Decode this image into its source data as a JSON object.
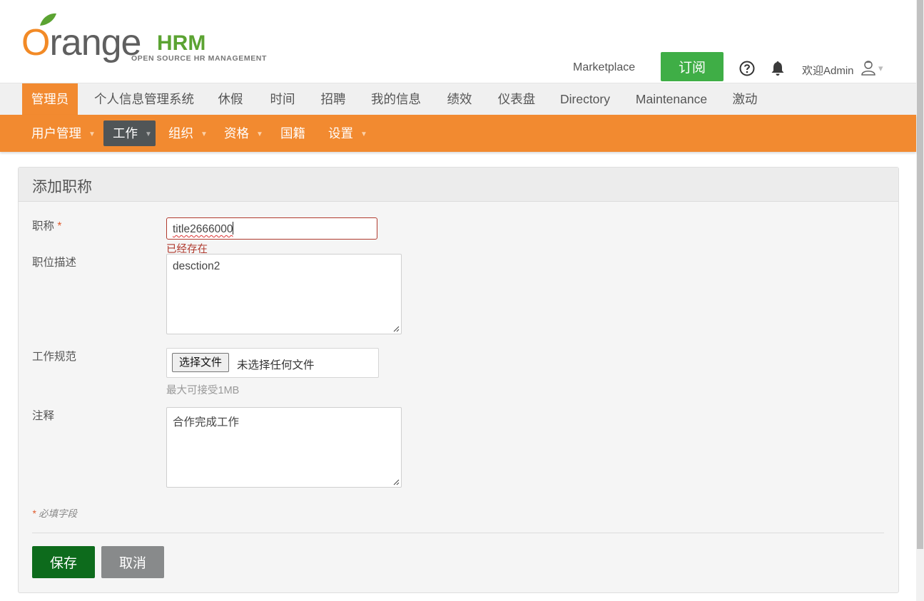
{
  "header": {
    "logo_main": "range",
    "logo_o": "O",
    "logo_hrm": "HRM",
    "logo_sub": "OPEN SOURCE HR MANAGEMENT",
    "marketplace_label": "Marketplace",
    "subscribe_label": "订阅",
    "welcome_text": "欢迎Admin",
    "caret": "▾"
  },
  "topnav": {
    "items": [
      {
        "label": "管理员",
        "active": true
      },
      {
        "label": "个人信息管理系统"
      },
      {
        "label": "休假"
      },
      {
        "label": "时间"
      },
      {
        "label": "招聘"
      },
      {
        "label": "我的信息"
      },
      {
        "label": "绩效"
      },
      {
        "label": "仪表盘"
      },
      {
        "label": "Directory"
      },
      {
        "label": "Maintenance"
      },
      {
        "label": "激动"
      }
    ]
  },
  "subnav": {
    "items": [
      {
        "label": "用户管理",
        "dropdown": true
      },
      {
        "label": "工作",
        "dropdown": true,
        "active": true
      },
      {
        "label": "组织",
        "dropdown": true
      },
      {
        "label": "资格",
        "dropdown": true
      },
      {
        "label": "国籍",
        "dropdown": false
      },
      {
        "label": "设置",
        "dropdown": true
      }
    ],
    "caret": "▼"
  },
  "form": {
    "title": "添加职称",
    "job_title_label": "职称",
    "required_mark": "*",
    "job_title_value": "title2666000",
    "job_title_error": "已经存在",
    "description_label": "职位描述",
    "description_value": "desction2",
    "spec_label": "工作规范",
    "file_button_label": "选择文件",
    "file_none_text": "未选择任何文件",
    "file_hint": "最大可接受1MB",
    "note_label": "注释",
    "note_value": "合作完成工作",
    "required_note": "* 必填字段",
    "save_label": "保存",
    "cancel_label": "取消"
  },
  "colors": {
    "brand_orange": "#f28a30",
    "subscribe_green": "#3fae46",
    "save_green": "#0d6b1c",
    "error_red": "#b03a2e",
    "active_subnav": "#505557"
  }
}
